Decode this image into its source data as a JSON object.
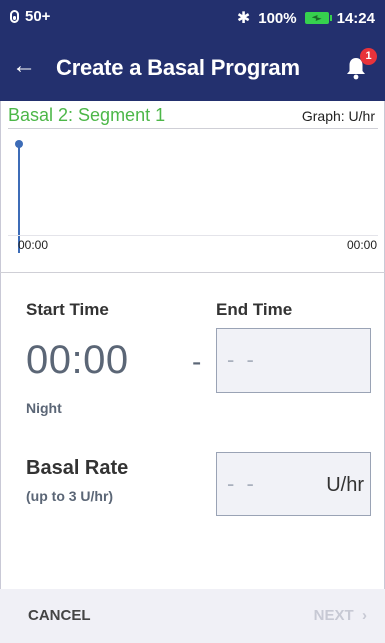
{
  "status_bar": {
    "pod_indicator": "50+",
    "battery_percent": "100%",
    "time": "14:24",
    "icons": [
      "pod-icon",
      "bluetooth-icon",
      "battery-icon"
    ]
  },
  "header": {
    "back_icon": "back-arrow-icon",
    "title": "Create a Basal Program",
    "notification_count": "1"
  },
  "graph": {
    "title": "Basal 2: Segment 1",
    "unit_label": "Graph: U/hr",
    "x_start": "00:00",
    "x_end": "00:00"
  },
  "form": {
    "start_time_label": "Start Time",
    "end_time_label": "End Time",
    "start_time_value": "00:00",
    "separator": "-",
    "end_time_placeholder": "- -",
    "period_label": "Night",
    "basal_rate_label": "Basal Rate",
    "basal_rate_hint": "(up to 3 U/hr)",
    "basal_rate_placeholder": "- -",
    "basal_rate_unit": "U/hr"
  },
  "footer": {
    "cancel_label": "CANCEL",
    "next_label": "NEXT",
    "next_icon": "chevron-right-icon"
  },
  "colors": {
    "header_bg": "#23306e",
    "segment_title": "#4cb748",
    "graph_marker": "#3d6cb7",
    "badge": "#e8333b",
    "battery": "#36d14e"
  }
}
